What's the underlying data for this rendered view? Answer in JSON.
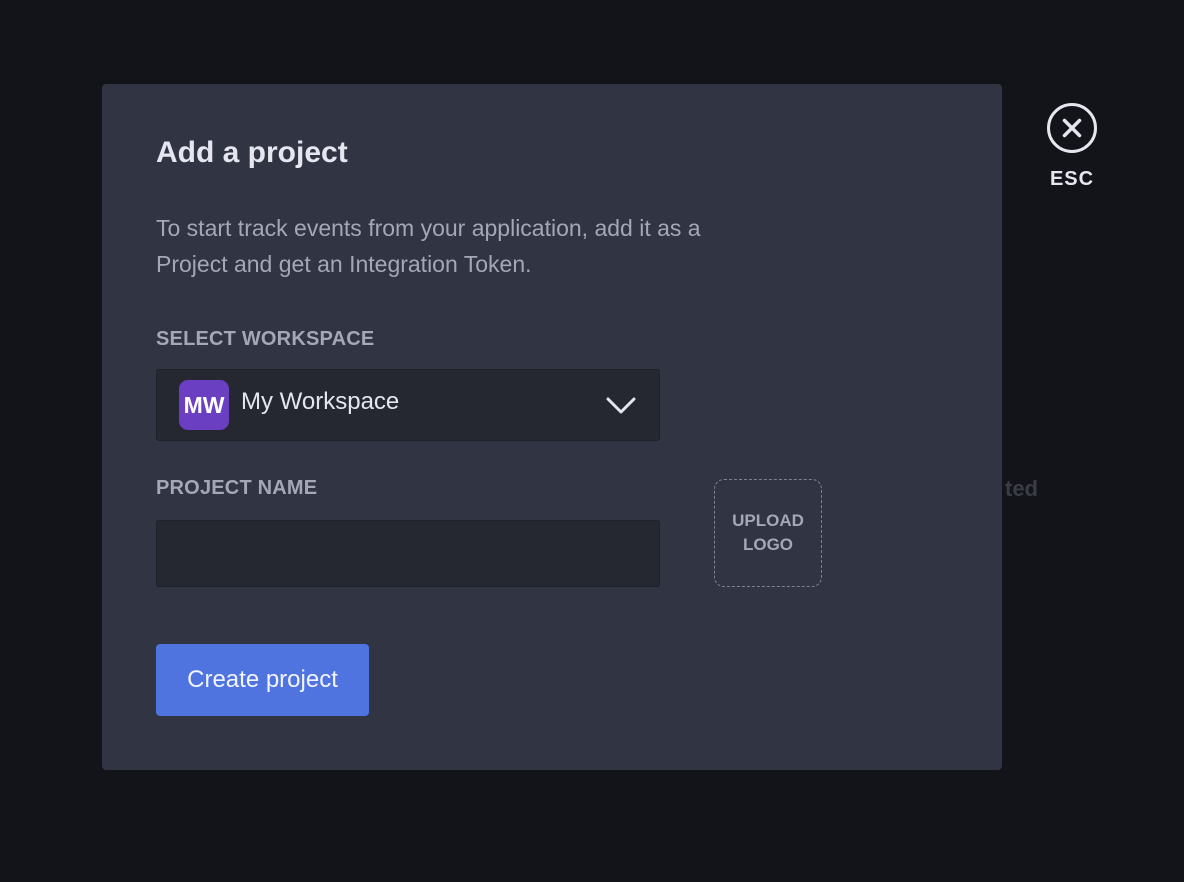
{
  "background": {
    "partial_text": "ted"
  },
  "close": {
    "esc_label": "ESC",
    "icon": "close-circle-icon"
  },
  "modal": {
    "title": "Add a project",
    "description": "To start track events from your application, add it as a Project and get an Integration Token.",
    "workspace": {
      "label": "SELECT WORKSPACE",
      "selected_initials": "MW",
      "selected_name": "My Workspace",
      "avatar_color": "#6a3fc1",
      "icon": "chevron-down-icon"
    },
    "project_name": {
      "label": "PROJECT NAME",
      "value": "",
      "placeholder": ""
    },
    "upload_logo": {
      "label": "UPLOAD\nLOGO"
    },
    "create_button": {
      "label": "Create project",
      "color": "#4f74e0"
    }
  }
}
